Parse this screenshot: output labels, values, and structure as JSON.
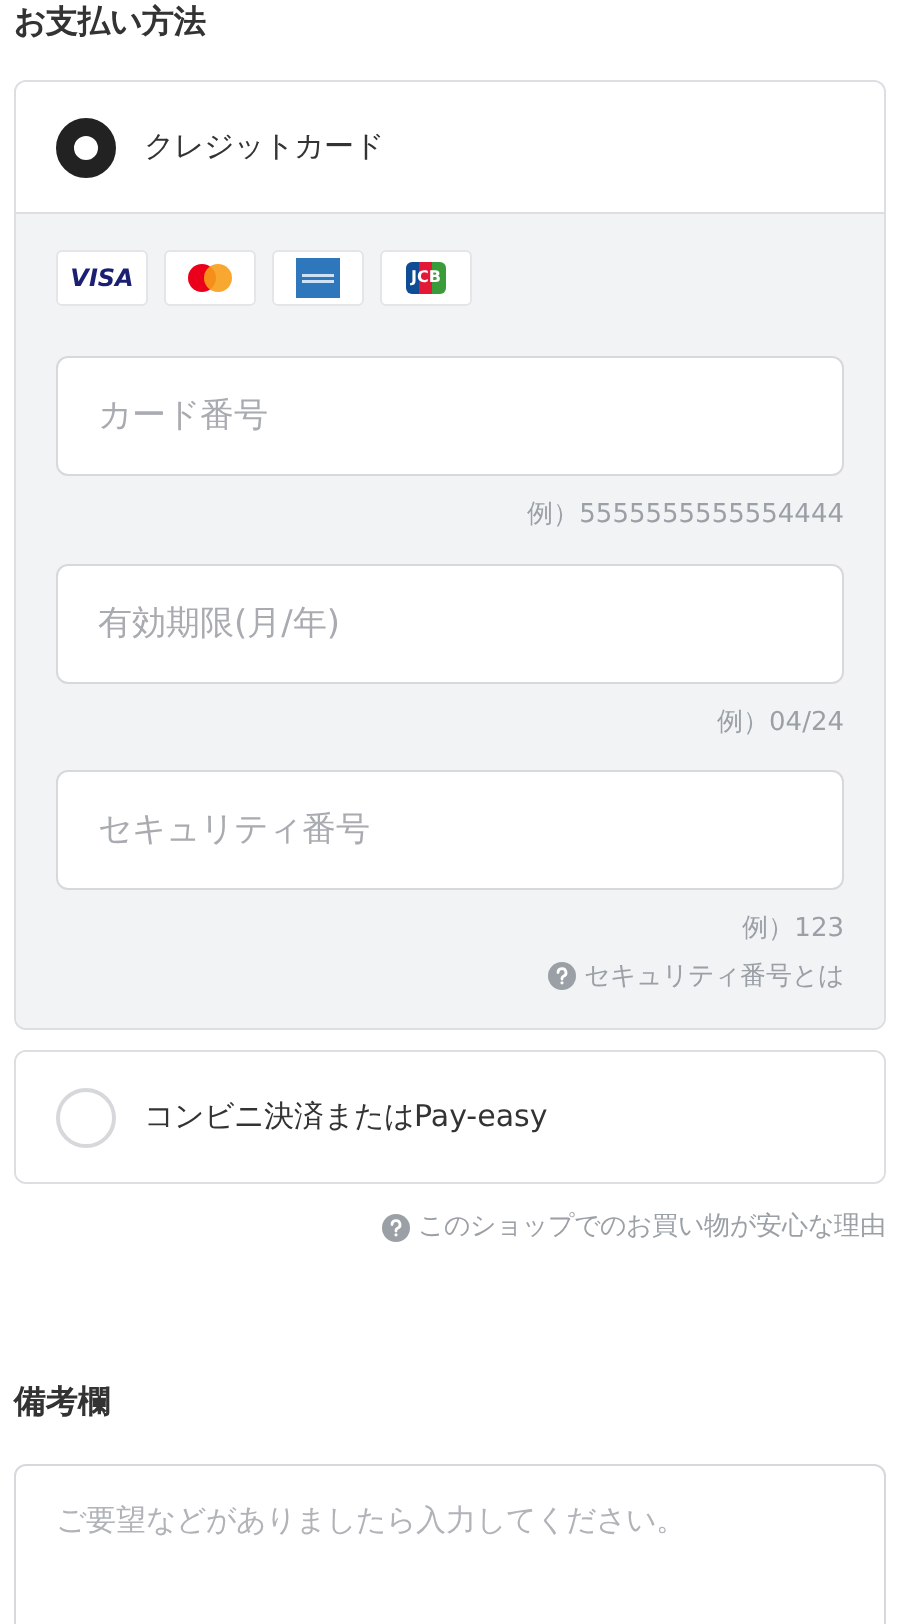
{
  "payment": {
    "title": "お支払い方法",
    "options": [
      {
        "label": "クレジットカード",
        "selected": true,
        "brands": [
          {
            "kind": "visa",
            "label": "VISA"
          },
          {
            "kind": "mastercard"
          },
          {
            "kind": "amex"
          },
          {
            "kind": "jcb",
            "label": "JCB"
          }
        ],
        "fields": [
          {
            "placeholder": "カード番号",
            "hint": "例）5555555555554444"
          },
          {
            "placeholder": "有効期限(月/年)",
            "hint": "例）04/24"
          },
          {
            "placeholder": "セキュリティ番号",
            "hint": "例）123"
          }
        ],
        "help_link": "セキュリティ番号とは"
      },
      {
        "label": "コンビニ決済またはPay-easy",
        "selected": false
      }
    ],
    "trust_link": "このショップでのお買い物が安心な理由"
  },
  "notes": {
    "title": "備考欄",
    "placeholder": "ご要望などがありましたら入力してください。"
  }
}
